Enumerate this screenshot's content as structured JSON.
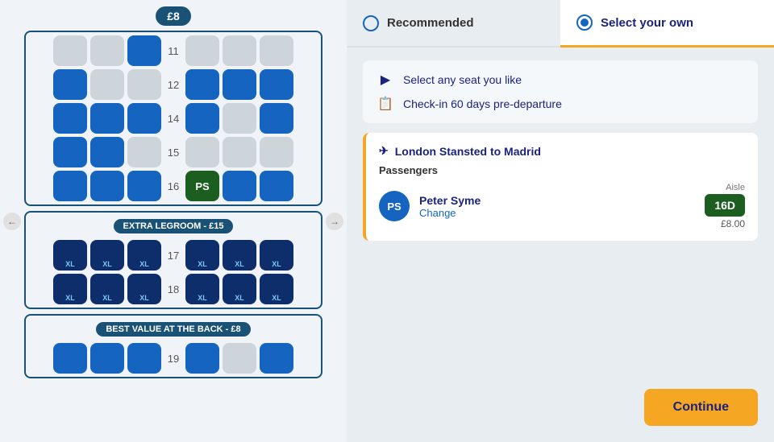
{
  "tabs": [
    {
      "id": "recommended",
      "label": "Recommended",
      "active": false
    },
    {
      "id": "select-your-own",
      "label": "Select your own",
      "active": true
    }
  ],
  "features": [
    {
      "icon": "✈",
      "text": "Select any seat you like"
    },
    {
      "icon": "📋",
      "text": "Check-in 60 days pre-departure"
    }
  ],
  "flight": {
    "route": "London Stansted to Madrid",
    "passengers_label": "Passengers"
  },
  "passenger": {
    "name": "Peter Syme",
    "initials": "PS",
    "change_label": "Change",
    "seat_code": "16D",
    "aisle_label": "Aisle",
    "price": "£8.00"
  },
  "price_badge": "£8",
  "extra_legroom_label": "EXTRA LEGROOM - £15",
  "best_value_label": "BEST VALUE AT THE BACK - £8",
  "continue_label": "Continue",
  "rows": {
    "r11": "11",
    "r12": "12",
    "r14": "14",
    "r15": "15",
    "r16": "16",
    "r17": "17",
    "r18": "18",
    "r19": "19"
  }
}
